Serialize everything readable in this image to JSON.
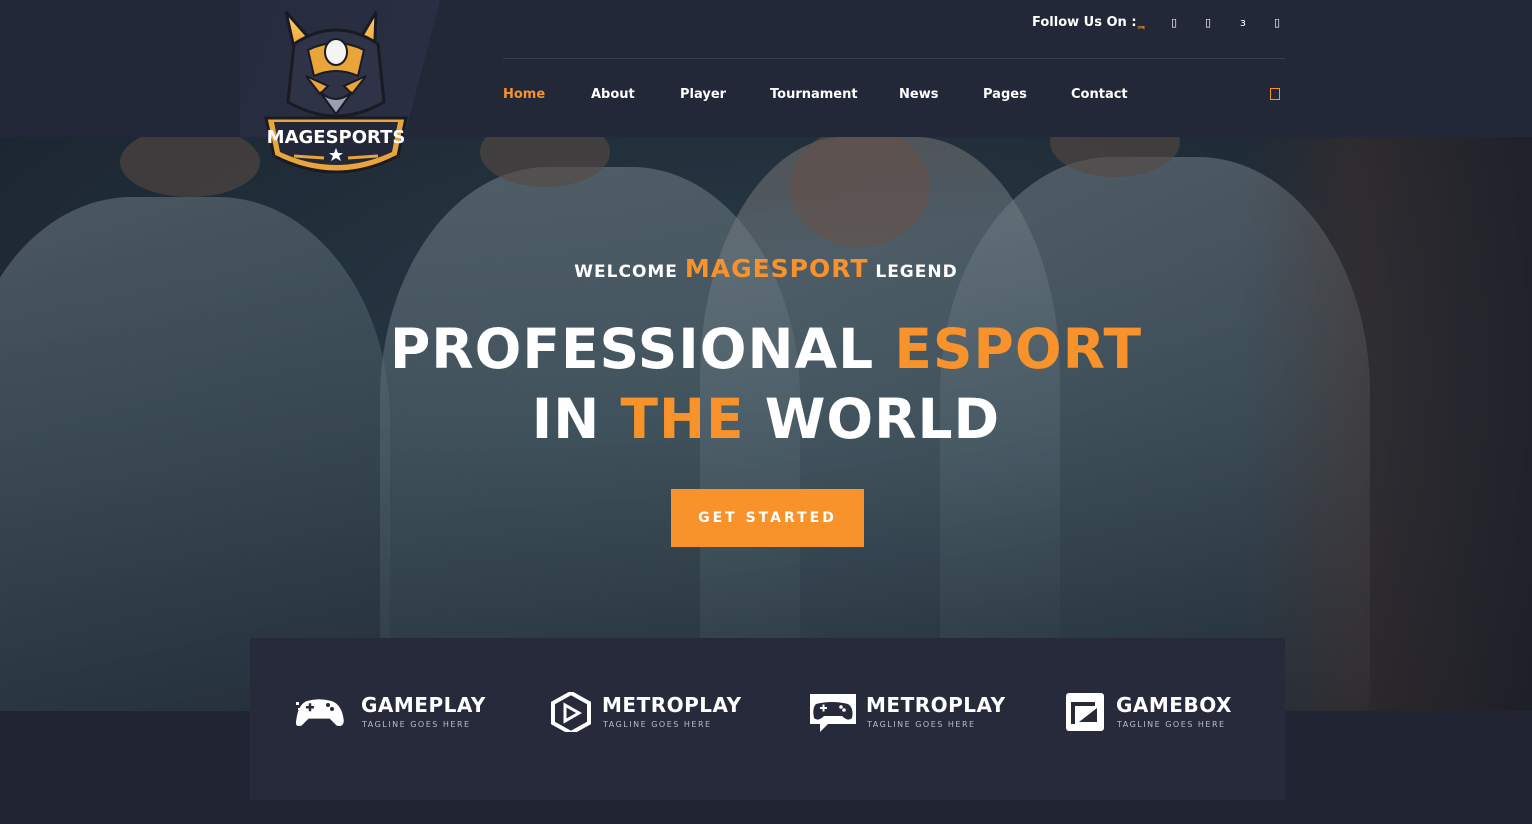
{
  "brand": {
    "logo_text": "MAGESPORTS"
  },
  "header": {
    "follow_label": "Follow Us On :",
    "social": [
      {
        "glyph": "ᆿ",
        "icon": "facebook-icon"
      },
      {
        "glyph": "▯",
        "icon": "twitter-icon"
      },
      {
        "glyph": "▯",
        "icon": "instagram-icon"
      },
      {
        "glyph": "з",
        "icon": "vimeo-icon"
      },
      {
        "glyph": "▯",
        "icon": "youtube-icon"
      }
    ]
  },
  "nav": {
    "items": [
      {
        "label": "Home",
        "active": true
      },
      {
        "label": "About"
      },
      {
        "label": "Player"
      },
      {
        "label": "Tournament"
      },
      {
        "label": "News"
      },
      {
        "label": "Pages"
      },
      {
        "label": "Contact"
      }
    ],
    "cart_icon": "cart-icon"
  },
  "hero": {
    "welcome_pre": "WELCOME",
    "welcome_brand": "MAGESPORT",
    "welcome_post": "LEGEND",
    "line1_white": "PROFESSIONAL",
    "line1_orange": "ESPORT",
    "line2_white_a": "IN",
    "line2_orange": "THE",
    "line2_white_b": "WORLD",
    "cta_label": "GET STARTED"
  },
  "sponsors": [
    {
      "name": "GAMEPLAY",
      "tagline": "TAGLINE GOES HERE",
      "icon": "gamepad-icon"
    },
    {
      "name": "METROPLAY",
      "tagline": "TAGLINE GOES HERE",
      "icon": "hex-play-icon"
    },
    {
      "name": "METROPLAY",
      "tagline": "TAGLINE GOES HERE",
      "icon": "gamepad-chat-icon"
    },
    {
      "name": "GAMEBOX",
      "tagline": "TAGLINE GOES HERE",
      "icon": "box-icon"
    }
  ],
  "colors": {
    "accent": "#f8922b",
    "header_bg": "#232839",
    "page_bg": "#212432",
    "sponsor_bg": "#262a3b"
  }
}
